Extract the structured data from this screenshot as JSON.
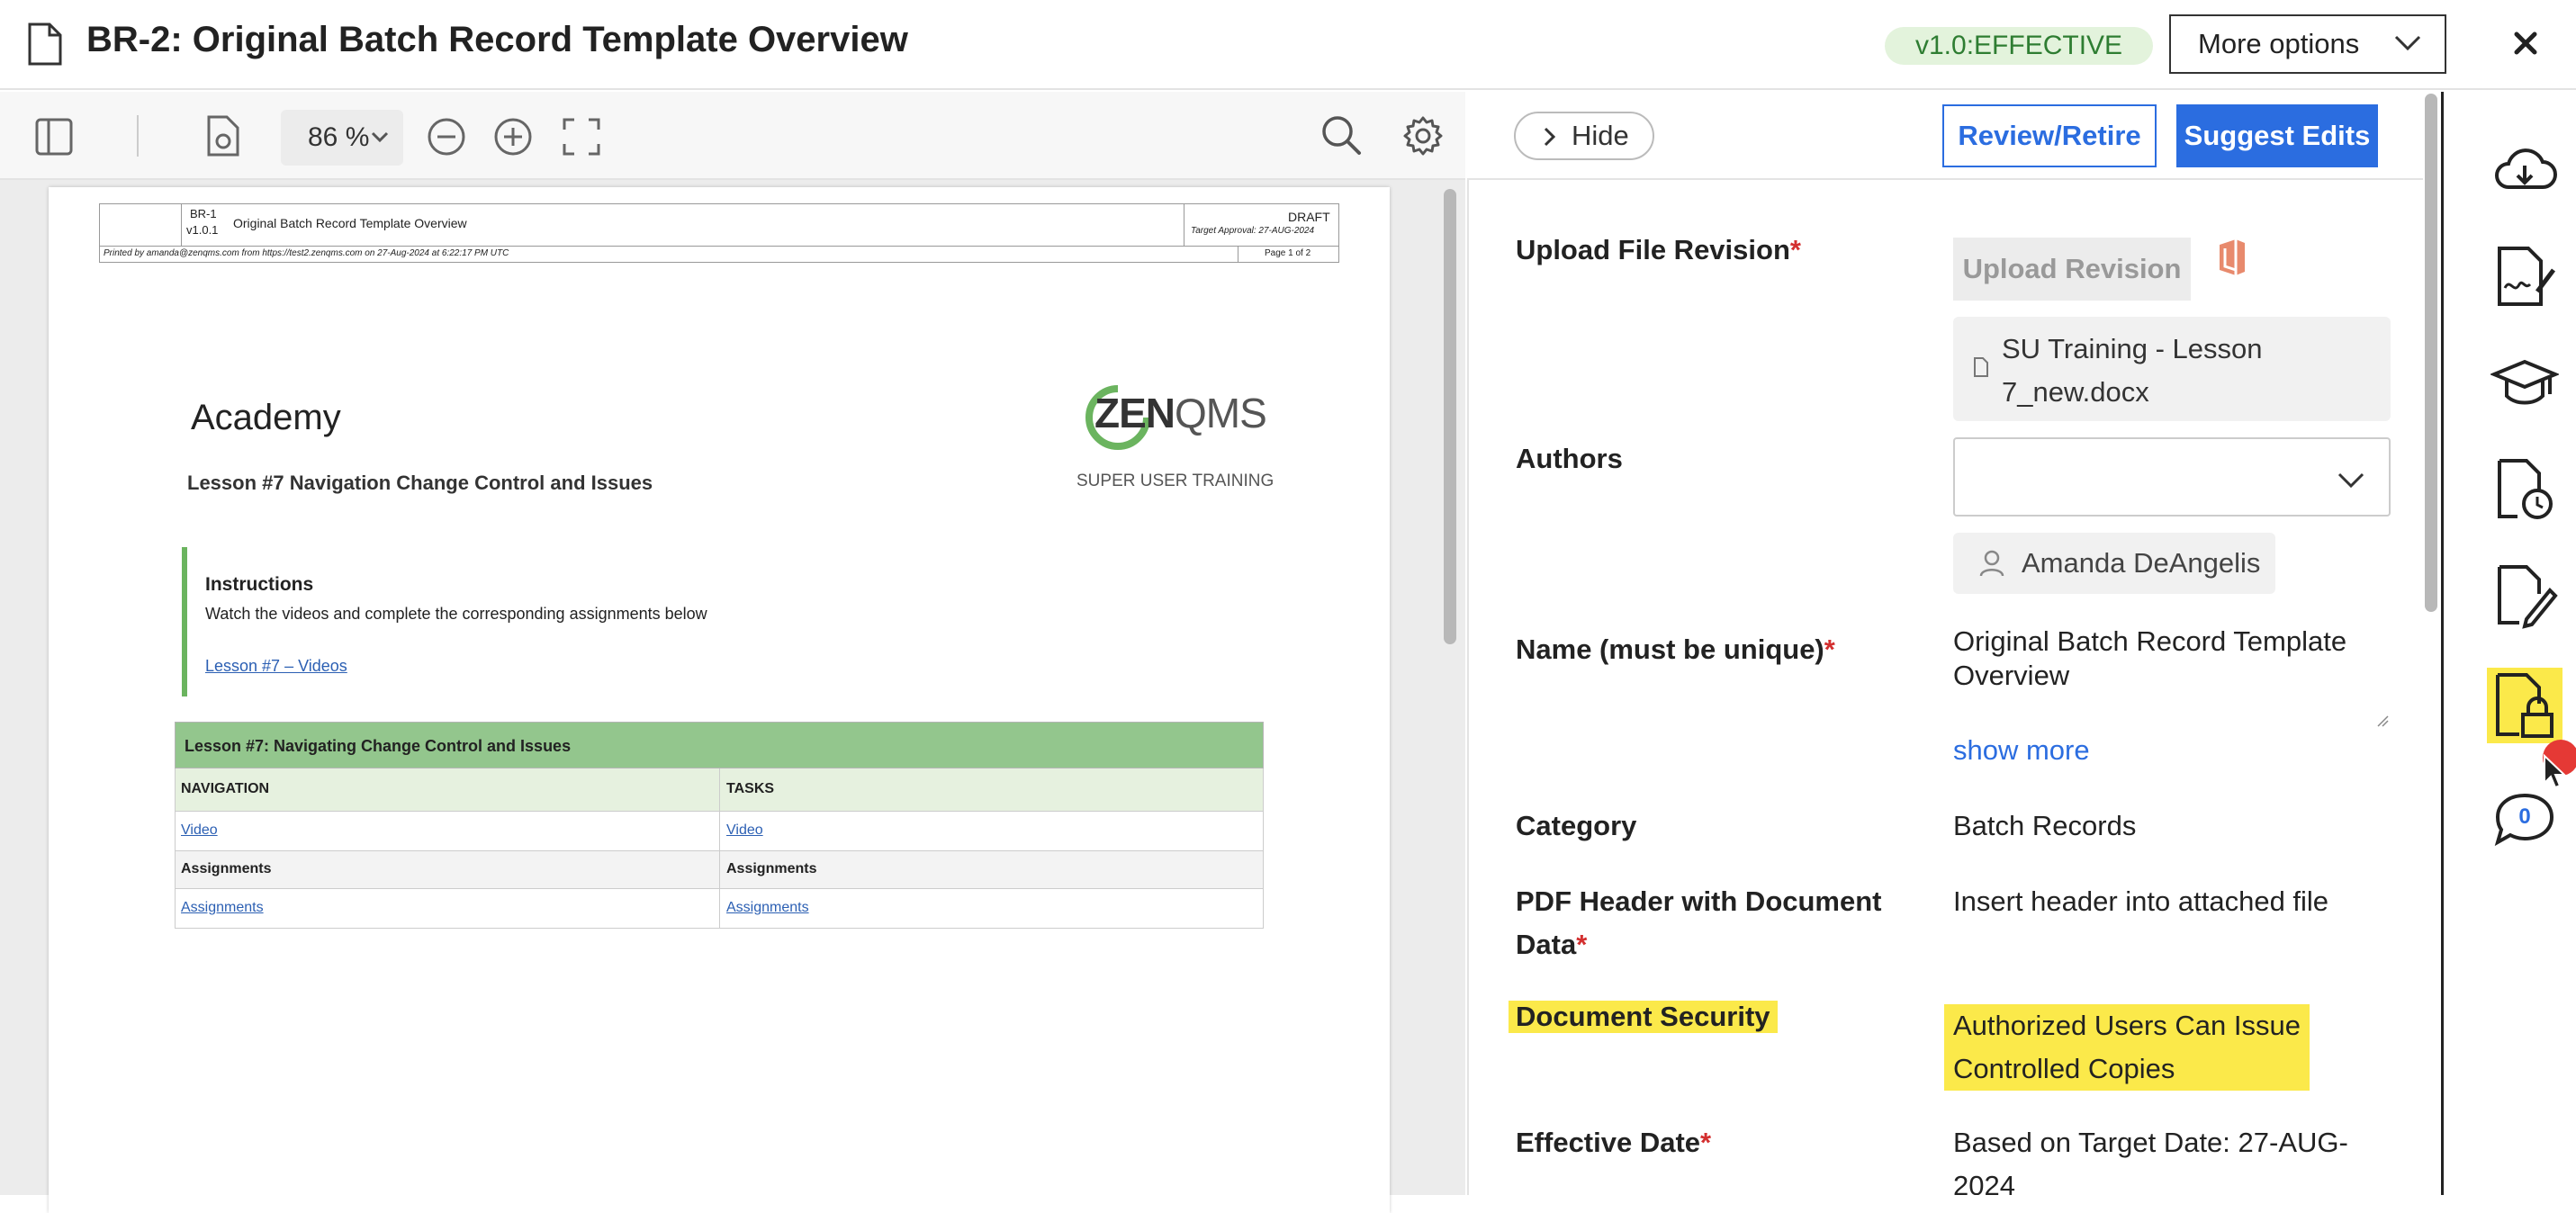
{
  "header": {
    "title": "BR-2: Original Batch Record Template Overview",
    "version_badge": "v1.0:EFFECTIVE",
    "more_options": "More options"
  },
  "viewer": {
    "zoom": "86 %",
    "pdf": {
      "header": {
        "doc_id": "BR-1",
        "doc_version": "v1.0.1",
        "doc_title": "Original Batch Record Template Overview",
        "status": "DRAFT",
        "target_approval": "Target Approval: 27-AUG-2024",
        "printed_by": "Printed by amanda@zenqms.com from https://test2.zenqms.com on 27-Aug-2024 at 6:22:17 PM UTC",
        "page": "Page 1 of 2"
      },
      "academy_title": "Academy",
      "logo_text": "ZENQMS",
      "lesson_title": "Lesson #7 Navigation Change Control and Issues",
      "super_user": "SUPER USER TRAINING",
      "instructions": {
        "heading": "Instructions",
        "body": "Watch the videos and complete the corresponding assignments below",
        "link": "Lesson #7 – Videos"
      },
      "table": {
        "title": "Lesson #7: Navigating Change Control and Issues",
        "col_left": "NAVIGATION",
        "col_right": "TASKS",
        "rows": [
          {
            "left": "Video",
            "right": "Video",
            "link": true
          },
          {
            "left": "Assignments",
            "right": "Assignments",
            "link": false
          },
          {
            "left": "Assignments",
            "right": "Assignments",
            "link": true
          }
        ]
      }
    }
  },
  "panel": {
    "hide": "Hide",
    "review_retire": "Review/Retire",
    "suggest_edits": "Suggest Edits",
    "fields": {
      "upload_label": "Upload File Revision",
      "upload_button": "Upload Revision",
      "file_name_1": "SU Training - Lesson",
      "file_name_2": "7_new.docx",
      "authors_label": "Authors",
      "author_chip": "Amanda DeAngelis",
      "name_label": "Name (must be unique)",
      "name_value_1": "Original Batch Record Template",
      "name_value_2": "Overview",
      "show_more": "show more",
      "category_label": "Category",
      "category_value": "Batch Records",
      "pdf_header_label_1": "PDF Header with Document",
      "pdf_header_label_2": "Data",
      "pdf_header_value": "Insert header into attached file",
      "security_label": "Document Security",
      "security_value_1": "Authorized Users Can Issue",
      "security_value_2": "Controlled Copies",
      "effective_label": "Effective Date",
      "effective_value_1": "Based on Target Date: 27-AUG-",
      "effective_value_2": "2024",
      "required_mark": "*"
    }
  },
  "rail": {
    "comment_count": "0"
  },
  "colors": {
    "accent": "#2b6de0",
    "highlight": "#fbe94a",
    "badge_bg": "#e3f3dc",
    "table_title_bg": "#93c68d"
  }
}
